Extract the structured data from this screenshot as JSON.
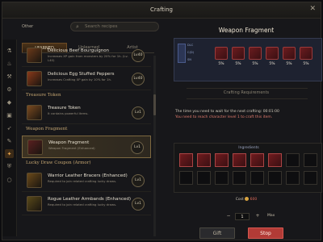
{
  "window": {
    "title": "Crafting",
    "close_glyph": "✕"
  },
  "filter": {
    "label": "Other",
    "search_placeholder": "Search recipes"
  },
  "tabs": [
    "LEARNED",
    "Unlearned",
    "Artist"
  ],
  "list": [
    {
      "kind": "item",
      "name": "Delicious Beef Bourguignon",
      "desc": "Increases XP gain from monsters by 20% for 1h. (Lv. L40)",
      "level": "Lv40",
      "thumb": "#6b3a1a"
    },
    {
      "kind": "item",
      "name": "Delicious Egg Stuffed Peppers",
      "desc": "Increases Crafting XP gain by 10% for 1h.",
      "level": "Lv40",
      "thumb": "#8a3a1a"
    },
    {
      "kind": "section",
      "name": "Treasure Token"
    },
    {
      "kind": "item",
      "name": "Treasure Token",
      "desc": "It contains powerful items.",
      "level": "Lv1",
      "thumb": "#7a4a20"
    },
    {
      "kind": "section",
      "name": "Weapon Fragment"
    },
    {
      "kind": "item",
      "name": "Weapon Fragment",
      "desc": "Weapon Fragment (Enhanced)",
      "level": "Lv1",
      "thumb": "#5a2020",
      "selected": true
    },
    {
      "kind": "section",
      "name": "Lucky Draw Coupon (Armor)"
    },
    {
      "kind": "item",
      "name": "Warrior Leather Bracers (Enhanced)",
      "desc": "Required to join related crafting lucky draws.",
      "level": "Lv1",
      "thumb": "#6b4a1a"
    },
    {
      "kind": "item",
      "name": "Rogue Leather Armbands (Enhanced)",
      "desc": "Required to join related crafting lucky draws.",
      "level": "Lv1",
      "thumb": "#5a4a1a"
    }
  ],
  "detail": {
    "title": "Weapon Fragment",
    "info": {
      "row_labels": [
        "DLC",
        "C(D)",
        "SN"
      ],
      "slots": [
        "5%",
        "5%",
        "5%",
        "5%",
        "5%",
        "5%"
      ]
    },
    "requirements_label": "Crafting Requirements",
    "req_line1": "The time you need to wait for the next crafting: 00:01:00",
    "req_line2": "You need to reach character level 1 to craft this item.",
    "ingredients_label": "Ingredients",
    "ingredients_filled": 6,
    "ingredients_total": 16,
    "cost_label": "Cost",
    "cost_value": "600",
    "quantity": "1",
    "minus": "−",
    "plus": "+",
    "max_label": "Max",
    "gift_label": "Gift",
    "stop_label": "Stop"
  }
}
